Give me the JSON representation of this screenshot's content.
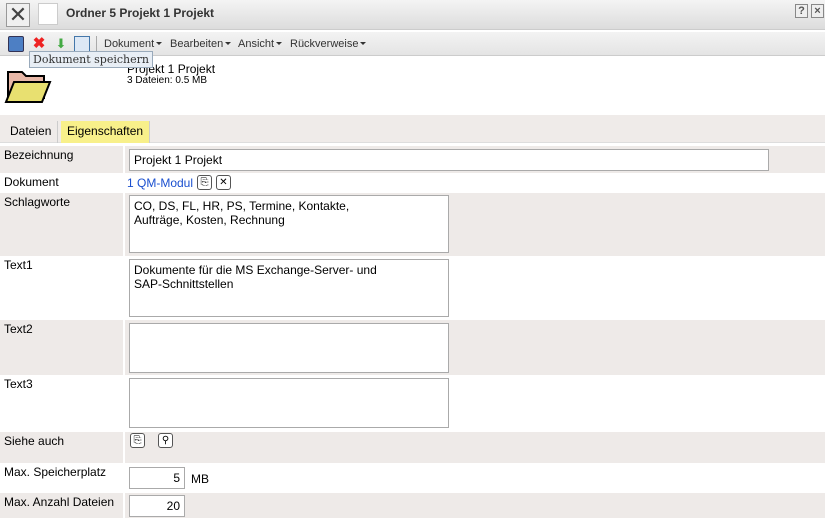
{
  "window": {
    "title": "Ordner 5 Projekt 1 Projekt",
    "help": "?",
    "close": "×"
  },
  "toolbar": {
    "menus": [
      "Dokument",
      "Bearbeiten",
      "Ansicht",
      "Rückverweise"
    ],
    "tooltip": "Dokument speichern"
  },
  "header": {
    "title": "Projekt 1 Projekt",
    "subtitle": "3 Dateien: 0.5 MB"
  },
  "tabs": [
    "Dateien",
    "Eigenschaften"
  ],
  "fields": {
    "bezeichnung": {
      "label": "Bezeichnung",
      "value": "Projekt 1 Projekt"
    },
    "dokument": {
      "label": "Dokument",
      "link": "1 QM-Modul"
    },
    "schlagworte": {
      "label": "Schlagworte",
      "value": "CO, DS, FL, HR, PS, Termine, Kontakte,\nAufträge, Kosten, Rechnung"
    },
    "text1": {
      "label": "Text1",
      "value": "Dokumente für die MS Exchange-Server- und\nSAP-Schnittstellen"
    },
    "text2": {
      "label": "Text2",
      "value": ""
    },
    "text3": {
      "label": "Text3",
      "value": ""
    },
    "siehe_auch": {
      "label": "Siehe auch"
    },
    "max_speicher": {
      "label": "Max. Speicherplatz",
      "value": "5",
      "unit": "MB"
    },
    "max_dateien": {
      "label": "Max. Anzahl Dateien",
      "value": "20"
    }
  }
}
